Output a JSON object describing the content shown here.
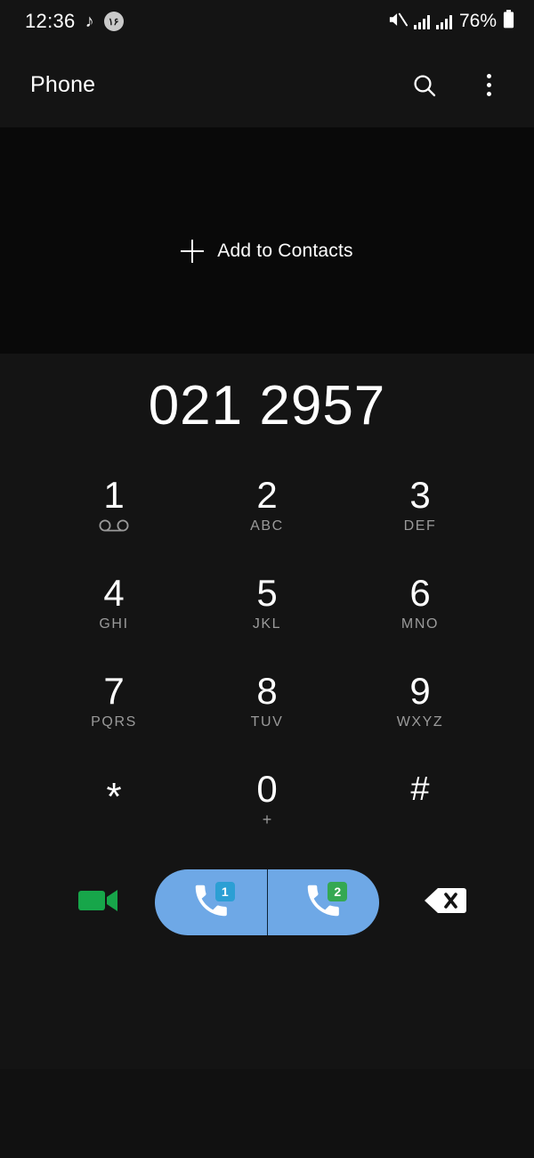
{
  "status_bar": {
    "time": "12:36",
    "music_icon": "music-note-icon",
    "app_badge_text": "۱۶",
    "mute_icon": "volume-mute-icon",
    "signal_1_icon": "signal-bars-sim1-icon",
    "signal_2_icon": "signal-bars-sim2-icon",
    "battery_percent": "76%",
    "battery_icon": "battery-icon"
  },
  "app_bar": {
    "title": "Phone",
    "search_icon": "search-icon",
    "more_icon": "more-options-icon"
  },
  "contacts_panel": {
    "add_to_contacts_label": "Add to Contacts",
    "plus_icon": "plus-icon"
  },
  "dialer": {
    "number": "021 2957",
    "keys": [
      {
        "digit": "1",
        "sub": "",
        "icon": "voicemail-icon"
      },
      {
        "digit": "2",
        "sub": "ABC",
        "icon": ""
      },
      {
        "digit": "3",
        "sub": "DEF",
        "icon": ""
      },
      {
        "digit": "4",
        "sub": "GHI",
        "icon": ""
      },
      {
        "digit": "5",
        "sub": "JKL",
        "icon": ""
      },
      {
        "digit": "6",
        "sub": "MNO",
        "icon": ""
      },
      {
        "digit": "7",
        "sub": "PQRS",
        "icon": ""
      },
      {
        "digit": "8",
        "sub": "TUV",
        "icon": ""
      },
      {
        "digit": "9",
        "sub": "WXYZ",
        "icon": ""
      },
      {
        "digit": "*",
        "sub": "",
        "icon": ""
      },
      {
        "digit": "0",
        "sub": "+",
        "icon": ""
      },
      {
        "digit": "#",
        "sub": "",
        "icon": ""
      }
    ]
  },
  "action_bar": {
    "video_call_icon": "video-camera-icon",
    "call_sim1_icon": "phone-handset-icon",
    "call_sim1_badge": "1",
    "call_sim2_icon": "phone-handset-icon",
    "call_sim2_badge": "2",
    "backspace_icon": "backspace-icon"
  },
  "colors": {
    "background": "#141414",
    "panel_background": "#090909",
    "call_button": "#6ea8e6",
    "sim1_badge": "#2c9fd4",
    "sim2_badge": "#34a853",
    "video_icon": "#17a64a",
    "primary_text": "#ffffff",
    "secondary_text": "#9a9a9a"
  }
}
